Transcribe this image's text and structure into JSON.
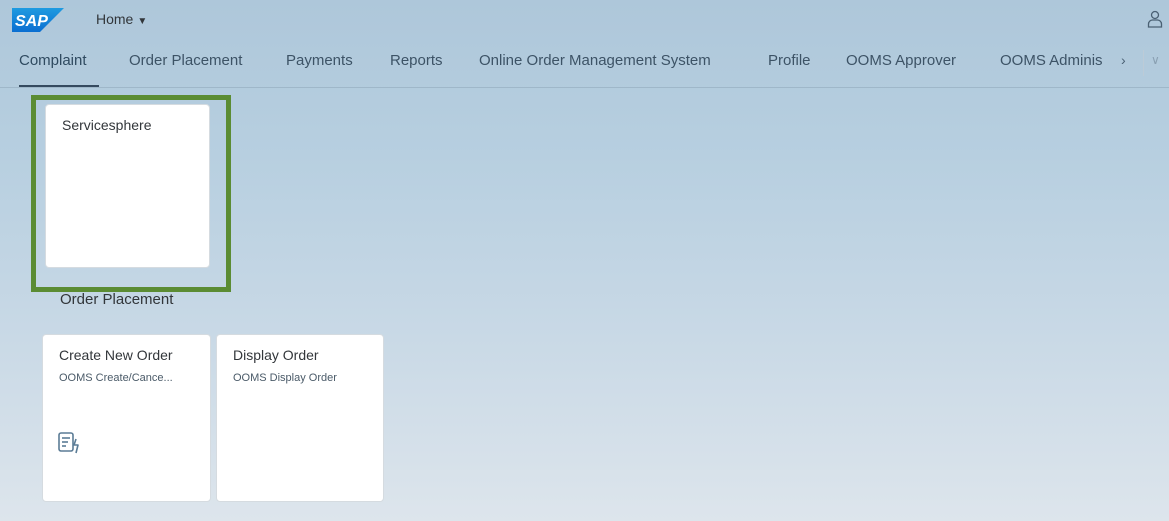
{
  "shell": {
    "logo_text": "SAP",
    "home_label": "Home",
    "brand_color": "#0a6ed1",
    "user_icon": "person-icon"
  },
  "tabs": [
    {
      "label": "Complaint",
      "selected": true
    },
    {
      "label": "Order Placement"
    },
    {
      "label": "Payments"
    },
    {
      "label": "Reports"
    },
    {
      "label": "Online Order Management System"
    },
    {
      "label": "Profile"
    },
    {
      "label": "OOMS Approver"
    },
    {
      "label": "OOMS Adminis"
    }
  ],
  "overflow": {
    "arrow": "›",
    "chevron": "∨"
  },
  "groups": [
    {
      "tiles": [
        {
          "title": "Servicesphere",
          "subtitle": ""
        }
      ]
    },
    {
      "title": "Order Placement",
      "tiles": [
        {
          "title": "Create New Order",
          "subtitle": "OOMS Create/Cance...",
          "icon": "order-form-icon"
        },
        {
          "title": "Display Order",
          "subtitle": "OOMS Display Order"
        }
      ]
    }
  ],
  "highlight_color": "#5b8c33"
}
